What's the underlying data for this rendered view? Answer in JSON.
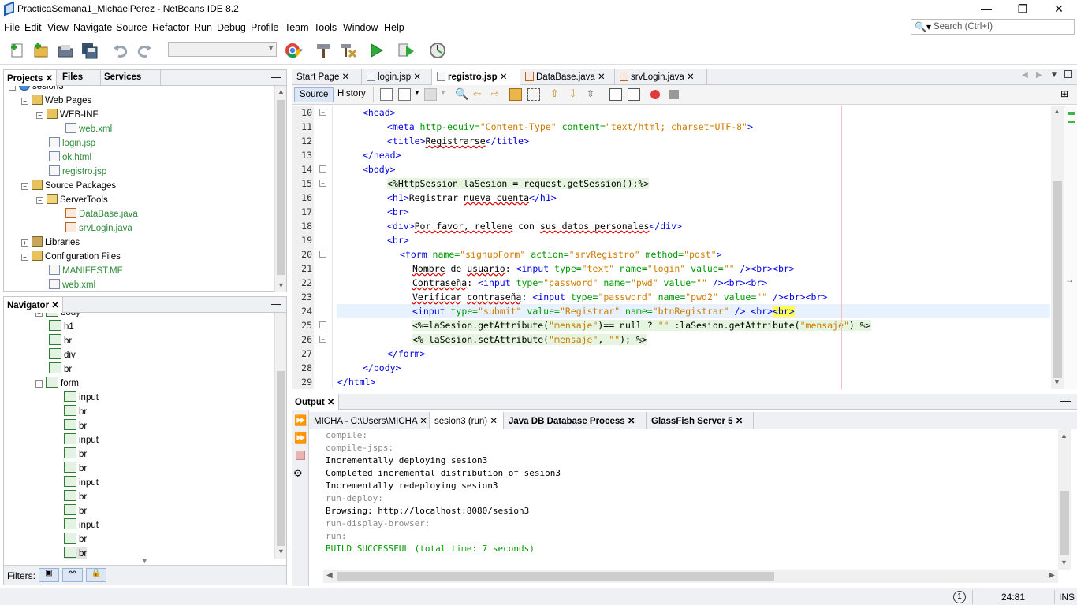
{
  "window": {
    "title": "PracticaSemana1_MichaelPerez - NetBeans IDE 8.2",
    "minimize": "—",
    "restore": "❐",
    "close": "✕"
  },
  "menu": [
    "File",
    "Edit",
    "View",
    "Navigate",
    "Source",
    "Refactor",
    "Run",
    "Debug",
    "Profile",
    "Team",
    "Tools",
    "Window",
    "Help"
  ],
  "search": {
    "placeholder": "Search (Ctrl+I)"
  },
  "projects": {
    "tabs": [
      "Projects",
      "Files",
      "Services"
    ],
    "nodes": [
      {
        "label": "sesion3",
        "depth": 0
      },
      {
        "label": "Web Pages",
        "depth": 1
      },
      {
        "label": "WEB-INF",
        "depth": 2
      },
      {
        "label": "web.xml",
        "depth": 3
      },
      {
        "label": "login.jsp",
        "depth": 2
      },
      {
        "label": "ok.html",
        "depth": 2
      },
      {
        "label": "registro.jsp",
        "depth": 2
      },
      {
        "label": "Source Packages",
        "depth": 1
      },
      {
        "label": "ServerTools",
        "depth": 2
      },
      {
        "label": "DataBase.java",
        "depth": 3
      },
      {
        "label": "srvLogin.java",
        "depth": 3
      },
      {
        "label": "Libraries",
        "depth": 1
      },
      {
        "label": "Configuration Files",
        "depth": 1
      },
      {
        "label": "MANIFEST.MF",
        "depth": 2
      },
      {
        "label": "web.xml",
        "depth": 2
      }
    ]
  },
  "navigator": {
    "title": "Navigator",
    "nodes": [
      "body",
      "h1",
      "br",
      "div",
      "br",
      "form",
      "input",
      "br",
      "br",
      "input",
      "br",
      "br",
      "input",
      "br",
      "br",
      "input",
      "br",
      "br"
    ],
    "filters_label": "Filters:"
  },
  "editor": {
    "tabs": [
      "Start Page",
      "login.jsp",
      "registro.jsp",
      "DataBase.java",
      "srvLogin.java"
    ],
    "active_tab": "registro.jsp",
    "modes": [
      "Source",
      "History"
    ],
    "line_numbers": [
      "10",
      "11",
      "12",
      "13",
      "14",
      "15",
      "16",
      "17",
      "18",
      "19",
      "20",
      "21",
      "22",
      "23",
      "24",
      "25",
      "26",
      "27",
      "28",
      "29"
    ],
    "code": {
      "l10": "<head>",
      "l11a": "<meta ",
      "l11b": "http-equiv=",
      "l11c": "\"Content-Type\"",
      "l11d": " content=",
      "l11e": "\"text/html; charset=UTF-8\"",
      "l11f": ">",
      "l12a": "<title>",
      "l12b": "Registrarse",
      "l12c": "</title>",
      "l13": "</head>",
      "l14": "<body>",
      "l15": "<%HttpSession laSesion = request.getSession();%>",
      "l16a": "<h1>",
      "l16b": "Registrar ",
      "l16c": "nueva cuenta",
      "l16d": "</h1>",
      "l17": "<br>",
      "l18a": "<div>",
      "l18b": "Por favor, ",
      "l18c": "rellene",
      "l18d": " con ",
      "l18e": "sus datos personales",
      "l18f": "</div>",
      "l19": "<br>",
      "l20a": "<form ",
      "l20b": "name=",
      "l20c": "\"signupForm\"",
      "l20d": " action=",
      "l20e": "\"srvRegistro\"",
      "l20f": " method=",
      "l20g": "\"post\"",
      "l20h": ">",
      "l21a": "Nombre",
      "l21b": " de ",
      "l21c": "usuario",
      "l21d": ": ",
      "l21e": "<input ",
      "l21f": "type=",
      "l21g": "\"text\"",
      "l21h": " name=",
      "l21i": "\"login\"",
      "l21j": " value=",
      "l21k": "\"\"",
      "l21l": " /><br><br>",
      "l22a": "Contraseña",
      "l22b": ": ",
      "l22c": "<input ",
      "l22d": "type=",
      "l22e": "\"password\"",
      "l22f": " name=",
      "l22g": "\"pwd\"",
      "l22h": " value=",
      "l22i": "\"\"",
      "l22j": " /><br><br>",
      "l23a": "Verificar",
      "l23b": " ",
      "l23c": "contraseña",
      "l23d": ": ",
      "l23e": "<input ",
      "l23f": "type=",
      "l23g": "\"password\"",
      "l23h": " name=",
      "l23i": "\"pwd2\"",
      "l23j": " value=",
      "l23k": "\"\"",
      "l23l": " /><br><br>",
      "l24a": "<input ",
      "l24b": "type=",
      "l24c": "\"submit\"",
      "l24d": " value=",
      "l24e": "\"Registrar\"",
      "l24f": " name=",
      "l24g": "\"btnRegistrar\"",
      "l24h": " /> <br>",
      "l24i": "<br>",
      "l25a": "<%=laSesion.getAttribute(",
      "l25b": "\"mensaje\"",
      "l25c": ")== null ? ",
      "l25d": "\"\"",
      "l25e": " :laSesion.getAttribute(",
      "l25f": "\"mensaje\"",
      "l25g": ") %>",
      "l26a": "<% laSesion.setAttribute(",
      "l26b": "\"mensaje\"",
      "l26c": ", ",
      "l26d": "\"\"",
      "l26e": "); %>",
      "l27": "</form>",
      "l28": "</body>",
      "l29": "</html>"
    }
  },
  "output": {
    "title": "Output",
    "tabs": [
      "MICHA - C:\\Users\\MICHA",
      "sesion3 (run)",
      "Java DB Database Process",
      "GlassFish Server 5"
    ],
    "lines": [
      {
        "t": "compile:",
        "c": "gray"
      },
      {
        "t": "compile-jsps:",
        "c": "gray"
      },
      {
        "t": "Incrementally deploying sesion3",
        "c": "black"
      },
      {
        "t": "Completed incremental distribution of sesion3",
        "c": "black"
      },
      {
        "t": "Incrementally redeploying sesion3",
        "c": "black"
      },
      {
        "t": "run-deploy:",
        "c": "gray"
      },
      {
        "t": "Browsing: http://localhost:8080/sesion3",
        "c": "black"
      },
      {
        "t": "run-display-browser:",
        "c": "gray"
      },
      {
        "t": "run:",
        "c": "gray"
      },
      {
        "t": "BUILD SUCCESSFUL (total time: 7 seconds)",
        "c": "green"
      }
    ]
  },
  "status": {
    "notifications": "1",
    "position": "24:81",
    "mode": "INS"
  }
}
